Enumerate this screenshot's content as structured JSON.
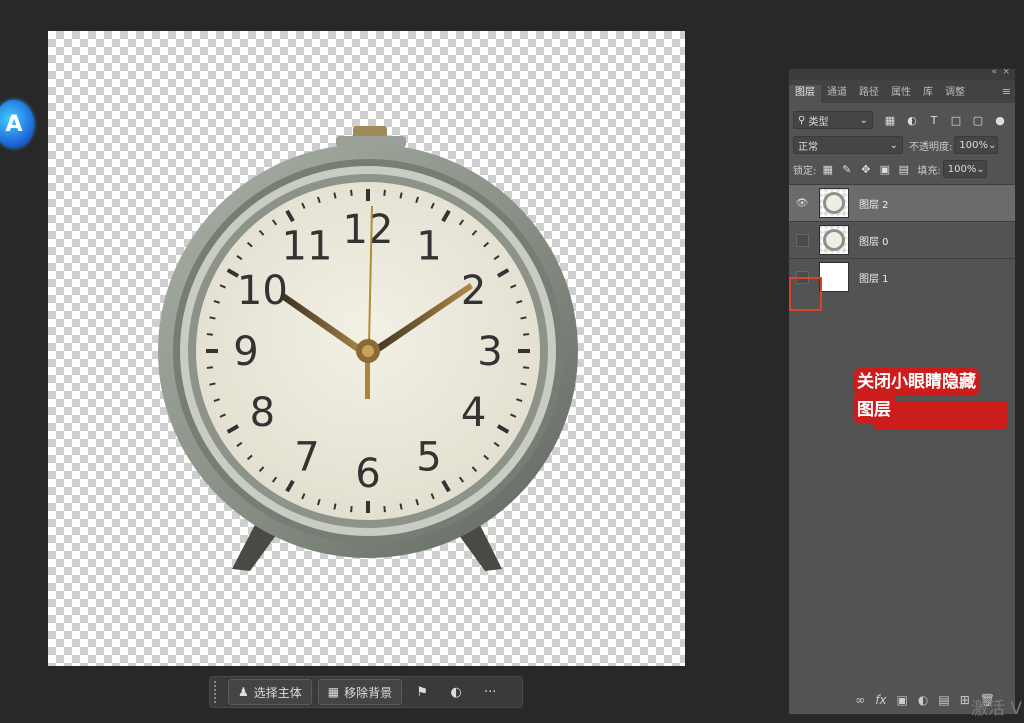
{
  "canvas": {
    "clock_numerals": [
      "12",
      "1",
      "2",
      "3",
      "4",
      "5",
      "6",
      "7",
      "8",
      "9",
      "10",
      "11"
    ]
  },
  "taskbar": {
    "select_subject": "选择主体",
    "remove_background": "移除背景",
    "more": "···"
  },
  "panel": {
    "tabs": [
      "图层",
      "通道",
      "路径",
      "属性",
      "库",
      "调整"
    ],
    "filter_kind": "类型",
    "blend_mode": "正常",
    "opacity_label": "不透明度:",
    "opacity_value": "100%",
    "lock_label": "锁定:",
    "fill_label": "填充:",
    "fill_value": "100%",
    "layers": [
      {
        "name": "图层 2",
        "visible": true,
        "selected": true,
        "thumb": "clock"
      },
      {
        "name": "图层 0",
        "visible": false,
        "selected": false,
        "thumb": "clock"
      },
      {
        "name": "图层 1",
        "visible": false,
        "selected": false,
        "thumb": "white"
      }
    ],
    "bottom_icons": [
      "link-icon",
      "fx-icon",
      "mask-icon",
      "adjustment-icon",
      "group-icon",
      "new-layer-icon",
      "delete-icon"
    ]
  },
  "annotation": {
    "line1": "关闭小眼睛隐藏",
    "line2": "图层",
    "color": "#cc1c1c"
  },
  "badge": {
    "letter": "A"
  },
  "watermark": "激活 V"
}
